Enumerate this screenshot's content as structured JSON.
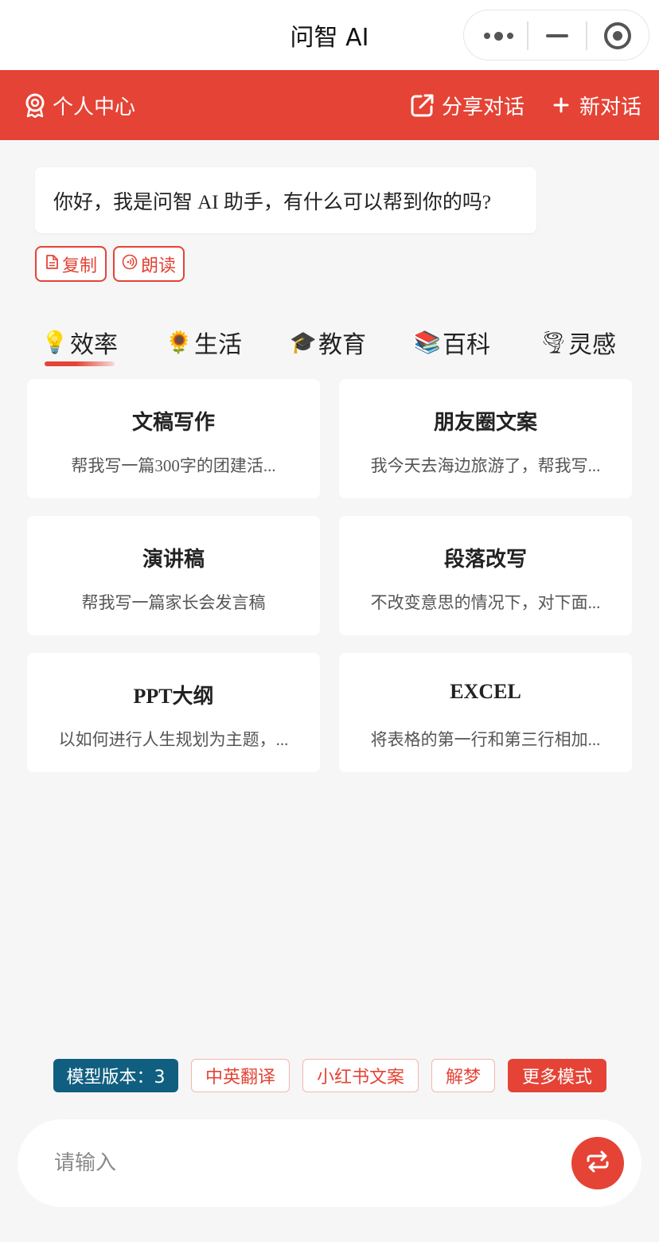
{
  "window": {
    "title": "问智 AI",
    "capsule": {
      "more_icon": "more-dots-icon",
      "minimize_icon": "minimize-icon",
      "close_icon": "target-circle-icon"
    }
  },
  "header": {
    "profile_label": "个人中心",
    "share_label": "分享对话",
    "new_chat_label": "新对话",
    "bg_color": "#e54335"
  },
  "greeting": {
    "text": "你好，我是问智 AI 助手，有什么可以帮到你的吗?",
    "copy_label": "复制",
    "read_label": "朗读"
  },
  "tabs": [
    {
      "icon": "💡",
      "label": "效率",
      "active": true
    },
    {
      "icon": "🌻",
      "label": "生活"
    },
    {
      "icon": "🎓",
      "label": "教育"
    },
    {
      "icon": "📚",
      "label": "百科"
    },
    {
      "icon": "🌪",
      "label": "灵感"
    }
  ],
  "cards": [
    {
      "title": "文稿写作",
      "desc": "帮我写一篇300字的团建活..."
    },
    {
      "title": "朋友圈文案",
      "desc": "我今天去海边旅游了，帮我写..."
    },
    {
      "title": "演讲稿",
      "desc": "帮我写一篇家长会发言稿"
    },
    {
      "title": "段落改写",
      "desc": "不改变意思的情况下，对下面..."
    },
    {
      "title": "PPT大纲",
      "desc": "以如何进行人生规划为主题，..."
    },
    {
      "title": "EXCEL",
      "desc": "将表格的第一行和第三行相加..."
    }
  ],
  "modes": {
    "model_version": "模型版本：3",
    "chips": [
      "中英翻译",
      "小红书文案",
      "解梦"
    ],
    "more_label": "更多模式",
    "model_color": "#115f80"
  },
  "input": {
    "placeholder": "请输入",
    "send_icon": "repeat-icon"
  }
}
